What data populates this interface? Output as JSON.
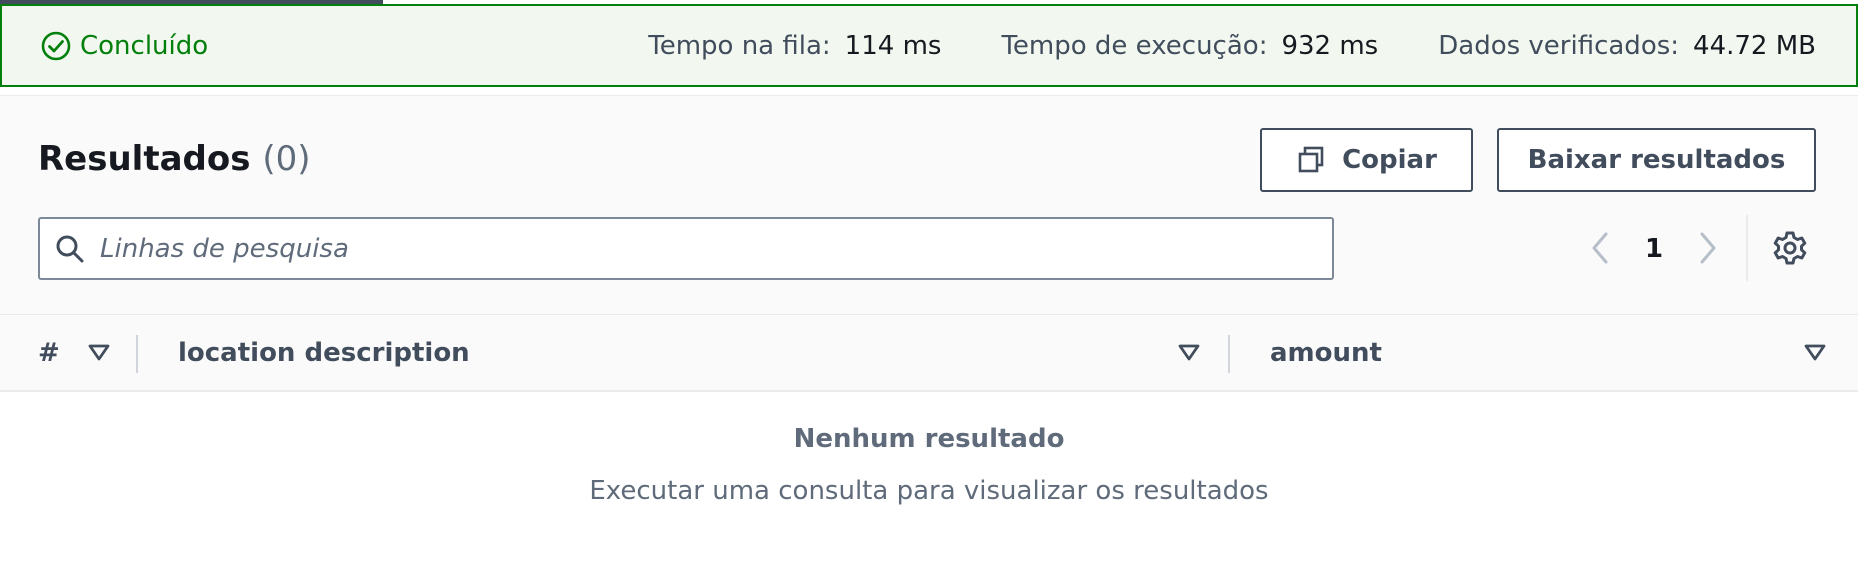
{
  "status": {
    "label": "Concluído",
    "color": "#037f0c",
    "icon": "check-circle-icon",
    "metrics": [
      {
        "label": "Tempo na fila:",
        "value": "114 ms"
      },
      {
        "label": "Tempo de execução:",
        "value": "932 ms"
      },
      {
        "label": "Dados verificados:",
        "value": "44.72 MB"
      }
    ]
  },
  "results": {
    "title": "Resultados",
    "count": "(0)",
    "copy_label": "Copiar",
    "download_label": "Baixar resultados",
    "search_placeholder": "Linhas de pesquisa",
    "search_value": "",
    "page": "1"
  },
  "table": {
    "columns": [
      {
        "label": "#"
      },
      {
        "label": "location description"
      },
      {
        "label": "amount"
      }
    ],
    "empty_title": "Nenhum resultado",
    "empty_subtitle": "Executar uma consulta para visualizar os resultados"
  }
}
